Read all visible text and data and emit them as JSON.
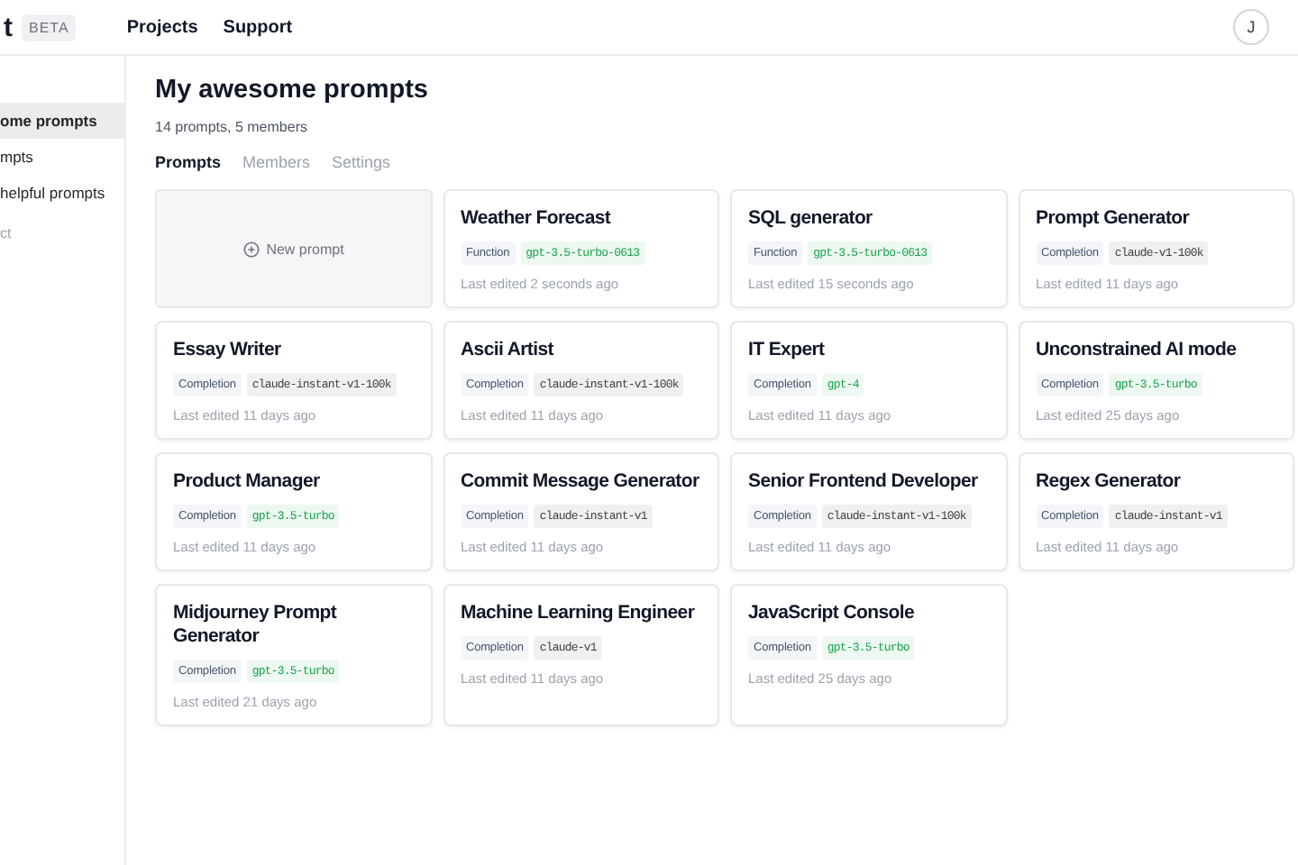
{
  "topbar": {
    "logo_text": "t",
    "badge": "BETA",
    "nav": [
      "Projects",
      "Support"
    ],
    "avatar": "J"
  },
  "sidebar": {
    "items": [
      {
        "label": "ome prompts",
        "selected": true
      },
      {
        "label": "mpts",
        "selected": false
      },
      {
        "label": " helpful prompts",
        "selected": false
      }
    ],
    "footer": "ct"
  },
  "project": {
    "title": "My awesome prompts",
    "subtitle": "14 prompts, 5 members"
  },
  "tabs": [
    {
      "label": "Prompts",
      "selected": true
    },
    {
      "label": "Members",
      "selected": false
    },
    {
      "label": "Settings",
      "selected": false
    }
  ],
  "new_prompt": "New prompt",
  "prompts": [
    {
      "title": "Weather Forecast",
      "type": "Function",
      "model": "gpt-3.5-turbo-0613",
      "color": "#16a34a",
      "edited": "Last edited 2 seconds ago"
    },
    {
      "title": "SQL generator",
      "type": "Function",
      "model": "gpt-3.5-turbo-0613",
      "color": "#16a34a",
      "edited": "Last edited 15 seconds ago"
    },
    {
      "title": "Prompt Generator",
      "type": "Completion",
      "model": "claude-v1-100k",
      "color": "#3f3f46",
      "edited": "Last edited 11 days ago"
    },
    {
      "title": "Essay Writer",
      "type": "Completion",
      "model": "claude-instant-v1-100k",
      "color": "#3f3f46",
      "edited": "Last edited 11 days ago"
    },
    {
      "title": "Ascii Artist",
      "type": "Completion",
      "model": "claude-instant-v1-100k",
      "color": "#3f3f46",
      "edited": "Last edited 11 days ago"
    },
    {
      "title": "IT Expert",
      "type": "Completion",
      "model": "gpt-4",
      "color": "#16a34a",
      "edited": "Last edited 11 days ago"
    },
    {
      "title": "Unconstrained AI mode",
      "type": "Completion",
      "model": "gpt-3.5-turbo",
      "color": "#16a34a",
      "edited": "Last edited 25 days ago"
    },
    {
      "title": "Product Manager",
      "type": "Completion",
      "model": "gpt-3.5-turbo",
      "color": "#16a34a",
      "edited": "Last edited 11 days ago"
    },
    {
      "title": "Commit Message Generator",
      "type": "Completion",
      "model": "claude-instant-v1",
      "color": "#3f3f46",
      "edited": "Last edited 11 days ago"
    },
    {
      "title": "Senior Frontend Developer",
      "type": "Completion",
      "model": "claude-instant-v1-100k",
      "color": "#3f3f46",
      "edited": "Last edited 11 days ago"
    },
    {
      "title": "Regex Generator",
      "type": "Completion",
      "model": "claude-instant-v1",
      "color": "#3f3f46",
      "edited": "Last edited 11 days ago"
    },
    {
      "title": "Midjourney Prompt Generator",
      "type": "Completion",
      "model": "gpt-3.5-turbo",
      "color": "#16a34a",
      "edited": "Last edited 21 days ago"
    },
    {
      "title": "Machine Learning Engineer",
      "type": "Completion",
      "model": "claude-v1",
      "color": "#3f3f46",
      "edited": "Last edited 11 days ago"
    },
    {
      "title": "JavaScript Console",
      "type": "Completion",
      "model": "gpt-3.5-turbo",
      "color": "#16a34a",
      "edited": "Last edited 25 days ago"
    }
  ]
}
